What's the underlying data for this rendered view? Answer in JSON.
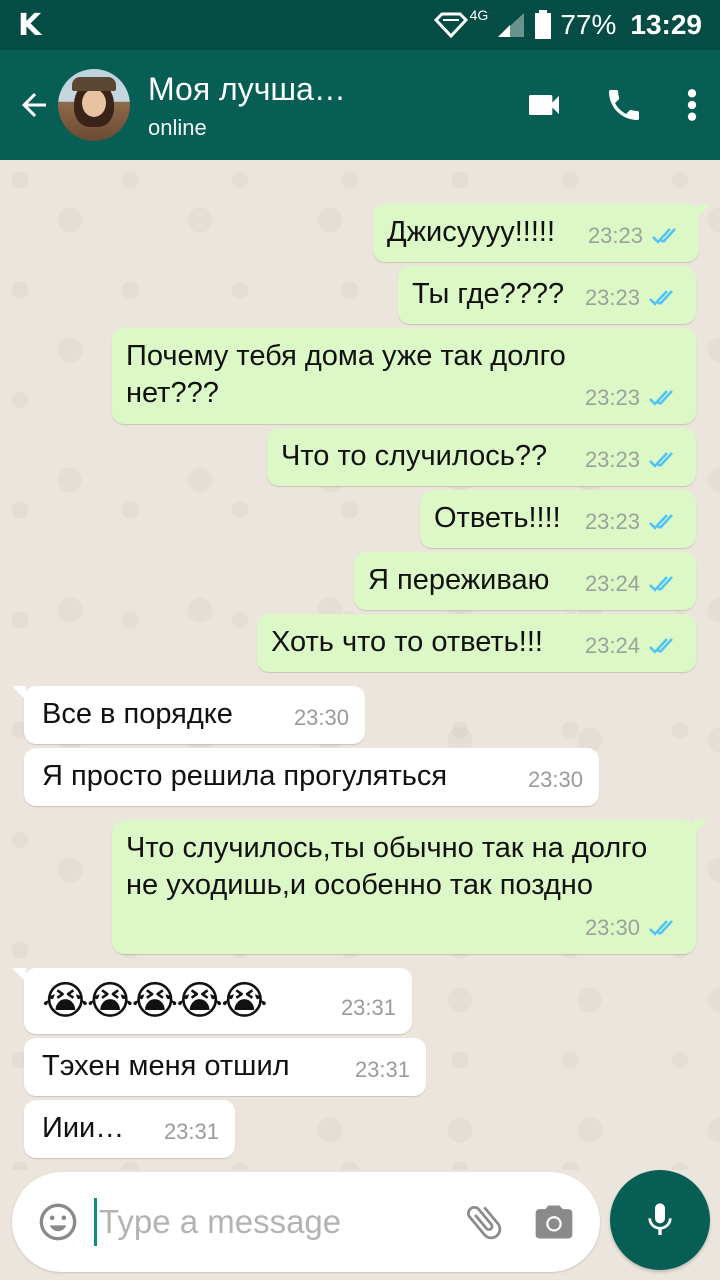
{
  "status_bar": {
    "carrier_logo": "K",
    "network": "4G",
    "battery": "77%",
    "time": "13:29"
  },
  "header": {
    "title": "Моя лучша…",
    "status": "online",
    "icons": [
      "back-arrow-icon",
      "video-call-icon",
      "phone-icon",
      "more-vert-icon"
    ]
  },
  "messages": [
    {
      "dir": "out",
      "text": "Джисуууу!!!!!",
      "time": "23:23",
      "ticks": "read"
    },
    {
      "dir": "out",
      "text": "Ты где????",
      "time": "23:23",
      "ticks": "read"
    },
    {
      "dir": "out",
      "text": "Почему тебя дома уже так долго нет???",
      "time": "23:23",
      "ticks": "read"
    },
    {
      "dir": "out",
      "text": "Что то случилось??",
      "time": "23:23",
      "ticks": "read"
    },
    {
      "dir": "out",
      "text": "Ответь!!!!",
      "time": "23:23",
      "ticks": "read"
    },
    {
      "dir": "out",
      "text": "Я переживаю",
      "time": "23:24",
      "ticks": "read"
    },
    {
      "dir": "out",
      "text": "Хоть что то ответь!!!",
      "time": "23:24",
      "ticks": "read"
    },
    {
      "dir": "in",
      "text": "Все в порядке",
      "time": "23:30"
    },
    {
      "dir": "in",
      "text": "Я просто решила прогуляться",
      "time": "23:30"
    },
    {
      "dir": "out",
      "text": "Что случилось,ты обычно так на долго не уходишь,и особенно так поздно",
      "time": "23:30",
      "ticks": "read"
    },
    {
      "dir": "in",
      "text": "😭😭😭😭😭",
      "time": "23:31"
    },
    {
      "dir": "in",
      "text": "Тэхен меня отшил",
      "time": "23:31"
    },
    {
      "dir": "in",
      "text": "Иии…",
      "time": "23:31"
    }
  ],
  "composer": {
    "placeholder": "Type a message",
    "icons": [
      "emoji-icon",
      "attach-icon",
      "camera-icon",
      "mic-icon"
    ]
  },
  "colors": {
    "header": "#075e54",
    "status_bar": "#054d44",
    "outgoing_bubble": "#dcf8c6",
    "incoming_bubble": "#ffffff",
    "read_ticks": "#4fc3f7"
  }
}
